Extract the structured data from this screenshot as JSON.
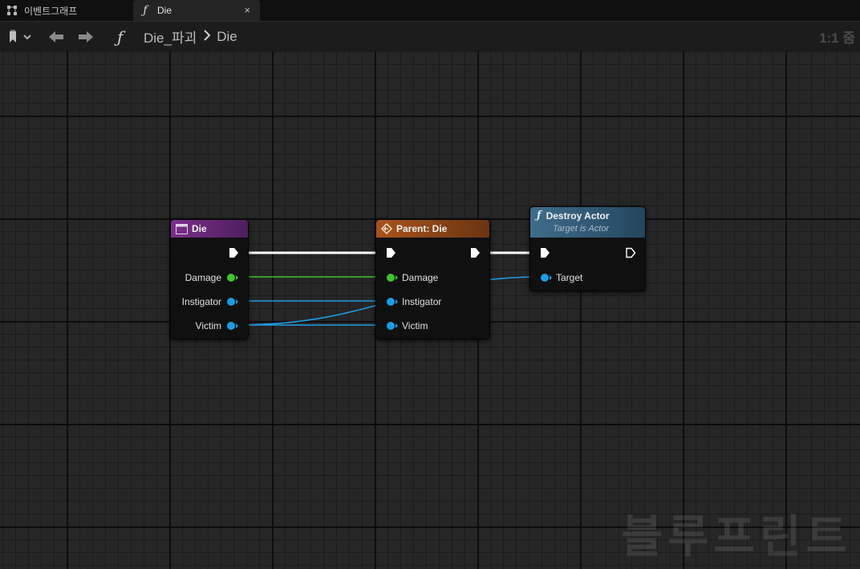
{
  "tabs": [
    {
      "label": "이벤트그래프",
      "icon": "event-graph-icon",
      "active": false
    },
    {
      "label": "Die",
      "icon": "function-icon",
      "active": true,
      "close": "×"
    }
  ],
  "toolbar": {
    "bookmark_icon": "bookmark-icon",
    "back_icon": "back-arrow-icon",
    "forward_icon": "forward-arrow-icon",
    "function_icon": "function-icon",
    "breadcrumb": {
      "parent": "Die_파괴",
      "separator": ">",
      "current": "Die"
    },
    "zoom": "1:1 줌"
  },
  "nodes": {
    "die_entry": {
      "title": "Die",
      "header_color": "#7b2f8c",
      "pins": [
        "Damage",
        "Instigator",
        "Victim"
      ]
    },
    "parent_die": {
      "title": "Parent: Die",
      "header_color": "#a8531c",
      "pins": [
        "Damage",
        "Instigator",
        "Victim"
      ]
    },
    "destroy_actor": {
      "title": "Destroy Actor",
      "subtitle": "Target is Actor",
      "header_color": "#3f6c8c",
      "pins": [
        "Target"
      ]
    }
  },
  "colors": {
    "exec": "#ffffff",
    "float_pin": "#3fc42b",
    "object_pin": "#1f9be6"
  },
  "watermark": "블루프린트"
}
